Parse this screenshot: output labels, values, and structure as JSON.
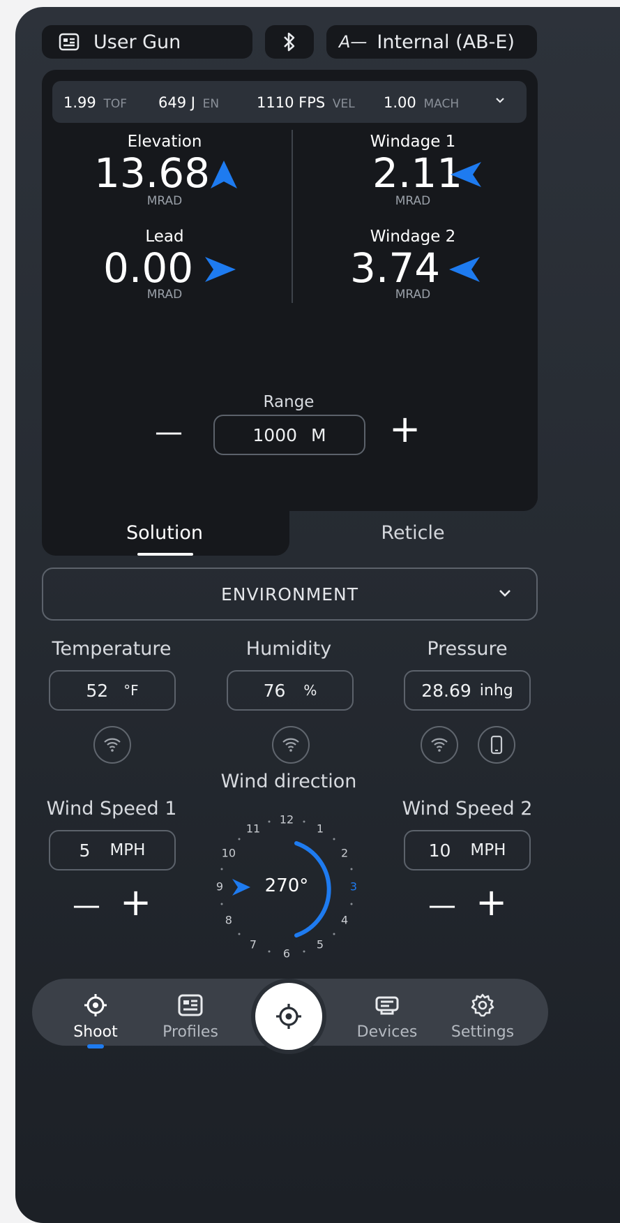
{
  "header": {
    "profile_label": "User Gun",
    "device_label": "Internal (AB-E)",
    "device_logo": "A—"
  },
  "stats": [
    {
      "value": "1.99",
      "unit": "TOF"
    },
    {
      "value": "649 J",
      "unit": "EN"
    },
    {
      "value": "1110 FPS",
      "unit": "VEL"
    },
    {
      "value": "1.00",
      "unit": "MACH"
    }
  ],
  "solution": {
    "elevation": {
      "label": "Elevation",
      "value": "13.68",
      "unit": "MRAD",
      "arrow": "up"
    },
    "windage1": {
      "label": "Windage 1",
      "value": "2.11",
      "unit": "MRAD",
      "arrow": "left"
    },
    "lead": {
      "label": "Lead",
      "value": "0.00",
      "unit": "MRAD",
      "arrow": "right"
    },
    "windage2": {
      "label": "Windage 2",
      "value": "3.74",
      "unit": "MRAD",
      "arrow": "left"
    }
  },
  "range": {
    "label": "Range",
    "value": "1000",
    "unit": "M",
    "minus": "—",
    "plus": "+"
  },
  "tabs": {
    "solution": "Solution",
    "reticle": "Reticle",
    "active": "Solution"
  },
  "environment": {
    "section_title": "ENVIRONMENT",
    "temperature": {
      "label": "Temperature",
      "value": "52",
      "unit": "°F"
    },
    "humidity": {
      "label": "Humidity",
      "value": "76",
      "unit": "%"
    },
    "pressure": {
      "label": "Pressure",
      "value": "28.69",
      "unit": "inhg"
    }
  },
  "wind": {
    "speed1": {
      "label": "Wind Speed 1",
      "value": "5",
      "unit": "MPH"
    },
    "speed2": {
      "label": "Wind Speed 2",
      "value": "10",
      "unit": "MPH"
    },
    "direction_label": "Wind direction",
    "direction_value": "270°",
    "clock": [
      "12",
      "1",
      "2",
      "3",
      "4",
      "5",
      "6",
      "7",
      "8",
      "9",
      "10",
      "11"
    ],
    "highlight_hour": "3",
    "minus": "—",
    "plus": "+"
  },
  "nav": {
    "items": [
      {
        "label": "Shoot",
        "icon": "crosshair-icon",
        "active": true
      },
      {
        "label": "Profiles",
        "icon": "profile-card-icon",
        "active": false
      },
      {
        "label": "Devices",
        "icon": "devices-icon",
        "active": false
      },
      {
        "label": "Settings",
        "icon": "gear-icon",
        "active": false
      }
    ]
  },
  "colors": {
    "accent": "#1e7bf0",
    "panel": "#16181c",
    "background": "#2a2f36"
  }
}
